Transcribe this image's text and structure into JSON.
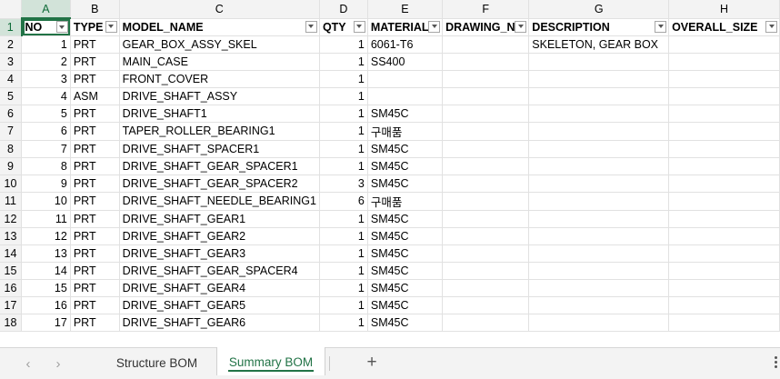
{
  "sheet": {
    "col_letters": [
      "A",
      "B",
      "C",
      "D",
      "E",
      "F",
      "G",
      "H"
    ],
    "header": [
      "NO",
      "TYPE",
      "MODEL_NAME",
      "QTY",
      "MATERIAL",
      "DRAWING_N",
      "DESCRIPTION",
      "OVERALL_SIZE"
    ],
    "rows": [
      {
        "n": "2",
        "no": "1",
        "type": "PRT",
        "model": "GEAR_BOX_ASSY_SKEL",
        "qty": "1",
        "material": "6061-T6",
        "drawing": "",
        "description": "SKELETON, GEAR BOX",
        "size": ""
      },
      {
        "n": "3",
        "no": "2",
        "type": "PRT",
        "model": "MAIN_CASE",
        "qty": "1",
        "material": "SS400",
        "drawing": "",
        "description": "",
        "size": ""
      },
      {
        "n": "4",
        "no": "3",
        "type": "PRT",
        "model": "FRONT_COVER",
        "qty": "1",
        "material": "",
        "drawing": "",
        "description": "",
        "size": ""
      },
      {
        "n": "5",
        "no": "4",
        "type": "ASM",
        "model": "DRIVE_SHAFT_ASSY",
        "qty": "1",
        "material": "",
        "drawing": "",
        "description": "",
        "size": ""
      },
      {
        "n": "6",
        "no": "5",
        "type": "PRT",
        "model": "DRIVE_SHAFT1",
        "qty": "1",
        "material": "SM45C",
        "drawing": "",
        "description": "",
        "size": ""
      },
      {
        "n": "7",
        "no": "6",
        "type": "PRT",
        "model": "TAPER_ROLLER_BEARING1",
        "qty": "1",
        "material": "구매품",
        "drawing": "",
        "description": "",
        "size": ""
      },
      {
        "n": "8",
        "no": "7",
        "type": "PRT",
        "model": "DRIVE_SHAFT_SPACER1",
        "qty": "1",
        "material": "SM45C",
        "drawing": "",
        "description": "",
        "size": ""
      },
      {
        "n": "9",
        "no": "8",
        "type": "PRT",
        "model": "DRIVE_SHAFT_GEAR_SPACER1",
        "qty": "1",
        "material": "SM45C",
        "drawing": "",
        "description": "",
        "size": ""
      },
      {
        "n": "10",
        "no": "9",
        "type": "PRT",
        "model": "DRIVE_SHAFT_GEAR_SPACER2",
        "qty": "3",
        "material": "SM45C",
        "drawing": "",
        "description": "",
        "size": ""
      },
      {
        "n": "11",
        "no": "10",
        "type": "PRT",
        "model": "DRIVE_SHAFT_NEEDLE_BEARING1",
        "qty": "6",
        "material": "구매품",
        "drawing": "",
        "description": "",
        "size": ""
      },
      {
        "n": "12",
        "no": "11",
        "type": "PRT",
        "model": "DRIVE_SHAFT_GEAR1",
        "qty": "1",
        "material": "SM45C",
        "drawing": "",
        "description": "",
        "size": ""
      },
      {
        "n": "13",
        "no": "12",
        "type": "PRT",
        "model": "DRIVE_SHAFT_GEAR2",
        "qty": "1",
        "material": "SM45C",
        "drawing": "",
        "description": "",
        "size": ""
      },
      {
        "n": "14",
        "no": "13",
        "type": "PRT",
        "model": "DRIVE_SHAFT_GEAR3",
        "qty": "1",
        "material": "SM45C",
        "drawing": "",
        "description": "",
        "size": ""
      },
      {
        "n": "15",
        "no": "14",
        "type": "PRT",
        "model": "DRIVE_SHAFT_GEAR_SPACER4",
        "qty": "1",
        "material": "SM45C",
        "drawing": "",
        "description": "",
        "size": ""
      },
      {
        "n": "16",
        "no": "15",
        "type": "PRT",
        "model": "DRIVE_SHAFT_GEAR4",
        "qty": "1",
        "material": "SM45C",
        "drawing": "",
        "description": "",
        "size": ""
      },
      {
        "n": "17",
        "no": "16",
        "type": "PRT",
        "model": "DRIVE_SHAFT_GEAR5",
        "qty": "1",
        "material": "SM45C",
        "drawing": "",
        "description": "",
        "size": ""
      },
      {
        "n": "18",
        "no": "17",
        "type": "PRT",
        "model": "DRIVE_SHAFT_GEAR6",
        "qty": "1",
        "material": "SM45C",
        "drawing": "",
        "description": "",
        "size": ""
      }
    ]
  },
  "tabs": {
    "prev_icon": "chevron-left-icon",
    "next_icon": "chevron-right-icon",
    "items": [
      {
        "label": "Structure BOM",
        "active": false
      },
      {
        "label": "Summary BOM",
        "active": true
      }
    ],
    "add_icon": "plus-icon",
    "accent": "#217346"
  }
}
